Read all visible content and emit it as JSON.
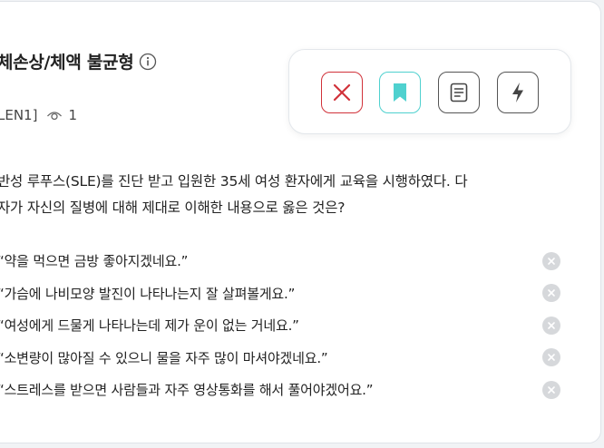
{
  "header": {
    "title": "체손상/체액 불균형",
    "code": "LEN1]",
    "views": "1"
  },
  "toolbar": {
    "icons": [
      "close-icon",
      "bookmark-icon",
      "note-icon",
      "lightning-icon"
    ],
    "colors": {
      "close": "#d1323a",
      "bookmark": "#4fd1cf",
      "neutral": "#555555"
    }
  },
  "question": {
    "line1": "반성 루푸스(SLE)를 진단 받고 입원한 35세 여성 환자에게 교육을 시행하였다. 다",
    "line2": "자가 자신의 질병에 대해 제대로 이해한 내용으로 옳은 것은?"
  },
  "options": [
    {
      "text": "“약을 먹으면 금방 좋아지겠네요.”"
    },
    {
      "text": "“가슴에 나비모양 발진이 나타나는지 잘 살펴볼게요.”"
    },
    {
      "text": "“여성에게 드물게 나타나는데 제가 운이 없는 거네요.”"
    },
    {
      "text": "“소변량이 많아질 수 있으니 물을 자주 많이 마셔야겠네요.”"
    },
    {
      "text": "“스트레스를 받으면 사람들과 자주 영상통화를 해서 풀어야겠어요.”"
    }
  ]
}
